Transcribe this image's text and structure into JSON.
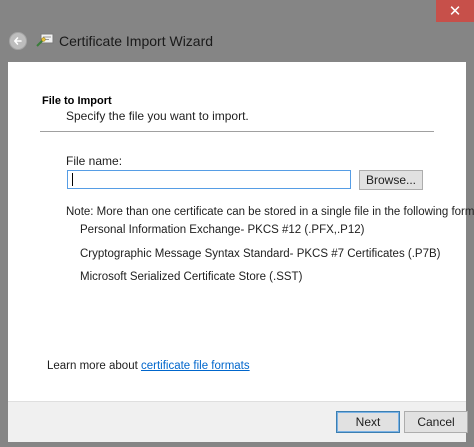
{
  "window": {
    "title": "Certificate Import Wizard",
    "close_glyph": "✕"
  },
  "section": {
    "title": "File to Import",
    "description": "Specify the file you want to import."
  },
  "file": {
    "label": "File name:",
    "value": "",
    "browse_label": "Browse..."
  },
  "note": "Note:  More than one certificate can be stored in a single file in the following formats:",
  "formats": [
    "Personal Information Exchange- PKCS #12 (.PFX,.P12)",
    "Cryptographic Message Syntax Standard- PKCS #7 Certificates (.P7B)",
    "Microsoft Serialized Certificate Store (.SST)"
  ],
  "learn_more": {
    "prefix": "Learn more about ",
    "link_text": "certificate file formats"
  },
  "buttons": {
    "next": "Next",
    "cancel": "Cancel"
  },
  "colors": {
    "titlebar": "#858585",
    "close": "#c7504a",
    "link": "#0066cc",
    "focus_border": "#569de5"
  },
  "icons": {
    "back": "back-arrow-icon",
    "wizard": "certificate-wizard-icon",
    "close": "close-icon"
  }
}
